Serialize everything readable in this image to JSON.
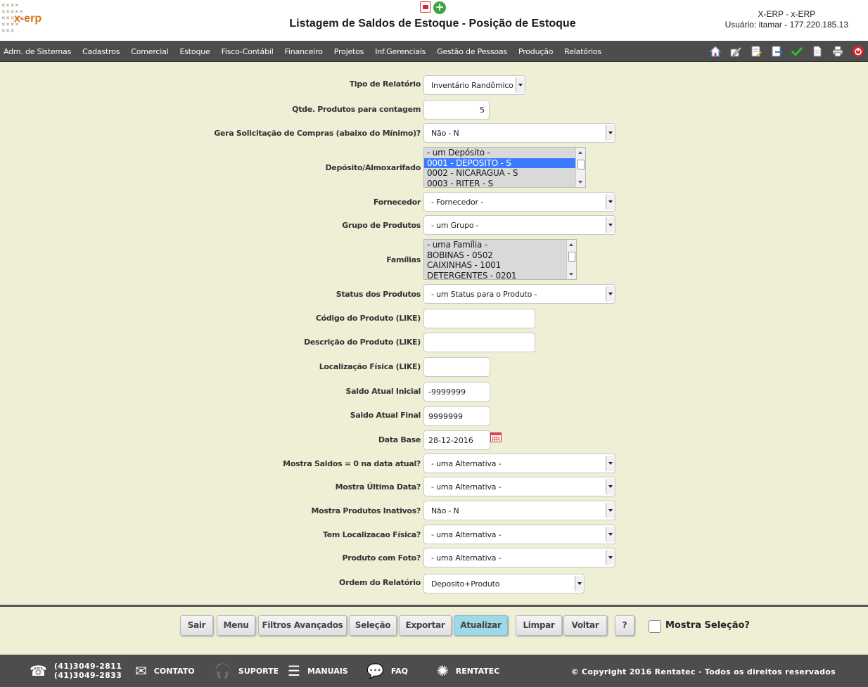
{
  "header": {
    "logo_text": "x-erp",
    "title": "Listagem de Saldos de Estoque - Posição de Estoque",
    "system": "X-ERP - x-ERP",
    "user": "Usuário: itamar - 177.220.185.13"
  },
  "menu": {
    "items": [
      "Adm. de Sistemas",
      "Cadastros",
      "Comercial",
      "Estoque",
      "Fisco-Contábil",
      "Financeiro",
      "Projetos",
      "Inf.Gerenciais",
      "Gestão de Pessoas",
      "Produção",
      "Relatórios"
    ],
    "tool_icons": [
      "home-icon",
      "edit-icon",
      "document-edit-icon",
      "export-icon",
      "check-icon",
      "new-document-icon",
      "print-icon",
      "power-icon"
    ]
  },
  "form": {
    "tipo_relatorio": {
      "label": "Tipo de Relatório",
      "value": "Inventário Randômico"
    },
    "qtde_produtos": {
      "label": "Qtde. Produtos para contagem",
      "value": "5"
    },
    "gera_solicitacao": {
      "label": "Gera Solicitação de Compras (abaixo do Mínimo)?",
      "value": "Não - N"
    },
    "deposito": {
      "label": "Depósito/Almoxarifado",
      "options": [
        "- um Depósito -",
        "0001 - DEPOSITO - S",
        "0002 - NICARAGUA - S",
        "0003 - RITER - S"
      ],
      "selected_index": 1
    },
    "fornecedor": {
      "label": "Fornecedor",
      "value": "- Fornecedor -"
    },
    "grupo_produtos": {
      "label": "Grupo de Produtos",
      "value": "- um Grupo -"
    },
    "familias": {
      "label": "Famílias",
      "options": [
        "- uma Família -",
        "BOBINAS - 0502",
        "CAIXINHAS - 1001",
        "DETERGENTES - 0201"
      ]
    },
    "status_produtos": {
      "label": "Status dos Produtos",
      "value": "- um Status para o Produto -"
    },
    "codigo_produto": {
      "label": "Código do Produto (LIKE)",
      "value": ""
    },
    "descricao_produto": {
      "label": "Descrição do Produto (LIKE)",
      "value": ""
    },
    "localizacao_fisica": {
      "label": "Localização Física (LIKE)",
      "value": ""
    },
    "saldo_inicial": {
      "label": "Saldo Atual Inicial",
      "value": "-9999999"
    },
    "saldo_final": {
      "label": "Saldo Atual Final",
      "value": "9999999"
    },
    "data_base": {
      "label": "Data Base",
      "value": "28-12-2016"
    },
    "mostra_saldos_zero": {
      "label": "Mostra Saldos = 0 na data atual?",
      "value": "- uma Alternativa -"
    },
    "mostra_ultima_data": {
      "label": "Mostra Última Data?",
      "value": "- uma Alternativa -"
    },
    "mostra_inativos": {
      "label": "Mostra Produtos Inativos?",
      "value": "Não - N"
    },
    "tem_localizacao": {
      "label": "Tem Localizacao Física?",
      "value": "- uma Alternativa -"
    },
    "produto_foto": {
      "label": "Produto com Foto?",
      "value": "- uma Alternativa -"
    },
    "ordem_relatorio": {
      "label": "Ordem do Relatório",
      "value": "Deposito+Produto"
    }
  },
  "actions": {
    "sair": "Sair",
    "menu": "Menu",
    "filtros": "Filtros Avançados",
    "selecao": "Seleção",
    "exportar": "Exportar",
    "atualizar": "Atualizar",
    "limpar": "Limpar",
    "voltar": "Voltar",
    "help": "?",
    "mostra_selecao": "Mostra Seleção?"
  },
  "footer": {
    "phone1": "(41)3049-2811",
    "phone2": "(41)3049-2833",
    "contato": "CONTATO",
    "suporte": "SUPORTE",
    "manuais": "MANUAIS",
    "faq": "FAQ",
    "rentatec": "RENTATEC",
    "copyright": "© Copyright 2016 Rentatec - Todos os direitos reservados"
  }
}
